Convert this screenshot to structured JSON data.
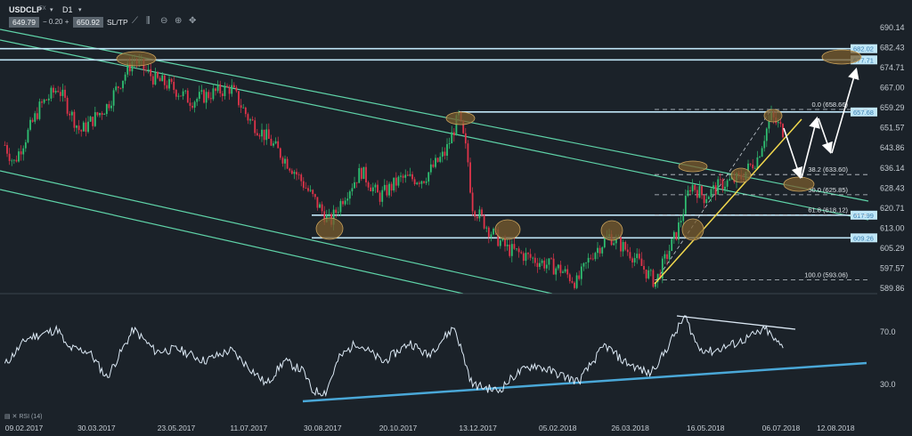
{
  "toolbar": {
    "symbol": "USDCLP",
    "market": "FX",
    "timeframe": "D1",
    "bid": "649.79",
    "spread_minus": "−",
    "spread": "0.20",
    "spread_plus": "+",
    "ask": "650.92",
    "sltp_label": "SL/TP",
    "tool_icons": [
      "line-chart-icon",
      "indicators-icon",
      "zoom-out-icon",
      "zoom-in-icon",
      "crosshair-icon"
    ]
  },
  "colors": {
    "background": "#1b2229",
    "bull": "#2fbf71",
    "bear": "#e0344a",
    "channel": "#5fd3a8",
    "level": "#bfe6f7",
    "trendline": "#f2d94e",
    "rsi_line": "#dce9f5",
    "rsi_trend": "#4aa8d8",
    "ellipse": "#7a5c2e"
  },
  "chart_data": [
    {
      "type": "candlestick",
      "title": "USDCLP D1",
      "ylim": [
        589.86,
        690.14
      ],
      "y_ticks": [
        "690.14",
        "682.43",
        "674.71",
        "667.00",
        "659.29",
        "651.57",
        "643.86",
        "636.14",
        "628.43",
        "620.71",
        "613.00",
        "605.29",
        "597.57",
        "589.86"
      ],
      "x_ticks": [
        "09.02.2017",
        "30.03.2017",
        "23.05.2017",
        "11.07.2017",
        "30.08.2017",
        "20.10.2017",
        "13.12.2017",
        "05.02.2018",
        "26.03.2018",
        "16.05.2018",
        "06.07.2018",
        "12.08.2018"
      ],
      "close_path": [
        [
          "2017-01-27",
          645
        ],
        [
          "2017-02-02",
          638
        ],
        [
          "2017-02-20",
          660
        ],
        [
          "2017-03-04",
          667
        ],
        [
          "2017-03-19",
          650
        ],
        [
          "2017-04-06",
          660
        ],
        [
          "2017-04-24",
          678
        ],
        [
          "2017-05-09",
          670
        ],
        [
          "2017-05-18",
          668
        ],
        [
          "2017-06-02",
          662
        ],
        [
          "2017-06-17",
          665
        ],
        [
          "2017-06-29",
          667
        ],
        [
          "2017-07-11",
          655
        ],
        [
          "2017-07-23",
          648
        ],
        [
          "2017-08-11",
          635
        ],
        [
          "2017-08-23",
          625
        ],
        [
          "2017-09-04",
          615
        ],
        [
          "2017-09-13",
          625
        ],
        [
          "2017-09-25",
          635
        ],
        [
          "2017-10-07",
          625
        ],
        [
          "2017-10-22",
          632
        ],
        [
          "2017-11-06",
          632
        ],
        [
          "2017-11-21",
          642
        ],
        [
          "2017-11-30",
          656
        ],
        [
          "2017-12-06",
          640
        ],
        [
          "2017-12-09",
          622
        ],
        [
          "2017-12-21",
          612
        ],
        [
          "2018-01-02",
          605
        ],
        [
          "2018-01-20",
          601
        ],
        [
          "2018-02-07",
          597
        ],
        [
          "2018-02-18",
          592
        ],
        [
          "2018-02-28",
          603
        ],
        [
          "2018-03-12",
          610
        ],
        [
          "2018-03-27",
          603
        ],
        [
          "2018-04-12",
          592
        ],
        [
          "2018-04-27",
          612
        ],
        [
          "2018-05-06",
          630
        ],
        [
          "2018-05-15",
          625
        ],
        [
          "2018-05-27",
          630
        ],
        [
          "2018-06-08",
          632
        ],
        [
          "2018-06-20",
          640
        ],
        [
          "2018-06-29",
          656
        ],
        [
          "2018-07-08",
          650
        ]
      ],
      "horizontal_levels": [
        {
          "label": "682.02",
          "value": 682.02
        },
        {
          "label": "677.71",
          "value": 677.71
        },
        {
          "label": "657.68",
          "value": 657.68
        },
        {
          "label": "617.99",
          "value": 617.99
        },
        {
          "label": "609.26",
          "value": 609.26
        }
      ],
      "fibonacci": [
        {
          "label": "0.0 (658.66)",
          "value": 658.66
        },
        {
          "label": "38.2 (633.60)",
          "value": 633.6
        },
        {
          "label": "50.0 (625.85)",
          "value": 625.85
        },
        {
          "label": "61.8 (618.12)",
          "value": 618.12
        },
        {
          "label": "100.0 (593.06)",
          "value": 593.06
        }
      ]
    },
    {
      "type": "line",
      "title": "RSI (14)",
      "y_ticks": [
        "70.0",
        "30.0"
      ],
      "rsi_path": [
        [
          "2017-01-27",
          45
        ],
        [
          "2017-02-11",
          65
        ],
        [
          "2017-03-04",
          72
        ],
        [
          "2017-03-10",
          58
        ],
        [
          "2017-03-25",
          55
        ],
        [
          "2017-04-06",
          35
        ],
        [
          "2017-04-24",
          72
        ],
        [
          "2017-05-09",
          55
        ],
        [
          "2017-05-24",
          57
        ],
        [
          "2017-06-11",
          48
        ],
        [
          "2017-06-29",
          56
        ],
        [
          "2017-07-14",
          40
        ],
        [
          "2017-07-23",
          30
        ],
        [
          "2017-08-04",
          48
        ],
        [
          "2017-08-17",
          40
        ],
        [
          "2017-08-23",
          25
        ],
        [
          "2017-09-01",
          24
        ],
        [
          "2017-09-10",
          50
        ],
        [
          "2017-09-22",
          62
        ],
        [
          "2017-10-10",
          47
        ],
        [
          "2017-10-28",
          62
        ],
        [
          "2017-11-09",
          52
        ],
        [
          "2017-11-27",
          74
        ],
        [
          "2017-12-09",
          30
        ],
        [
          "2017-12-27",
          25
        ],
        [
          "2018-01-08",
          38
        ],
        [
          "2018-01-20",
          45
        ],
        [
          "2018-02-19",
          32
        ],
        [
          "2018-03-09",
          60
        ],
        [
          "2018-03-21",
          48
        ],
        [
          "2018-04-08",
          38
        ],
        [
          "2018-04-17",
          52
        ],
        [
          "2018-05-02",
          82
        ],
        [
          "2018-05-11",
          58
        ],
        [
          "2018-05-20",
          55
        ],
        [
          "2018-06-07",
          62
        ],
        [
          "2018-06-26",
          72
        ],
        [
          "2018-07-02",
          63
        ],
        [
          "2018-07-08",
          58
        ]
      ]
    }
  ]
}
